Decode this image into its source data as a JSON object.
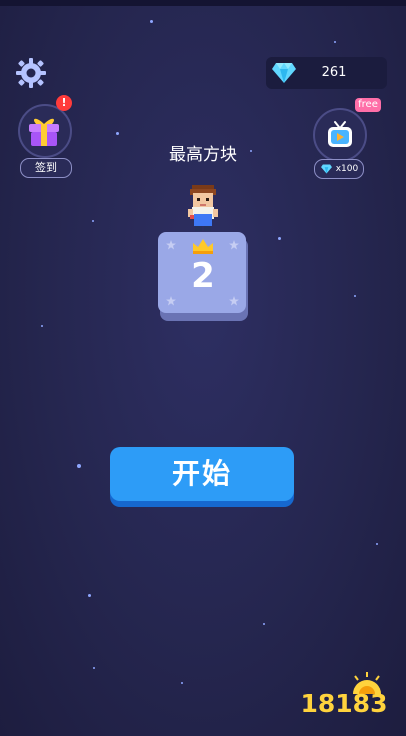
{
  "gems": {
    "count": "261",
    "icon": "diamond-icon"
  },
  "settings": {
    "icon": "gear-icon"
  },
  "checkin": {
    "icon": "gift-box-icon",
    "badge": "!",
    "label": "签到"
  },
  "video_reward": {
    "icon": "tv-play-icon",
    "badge": "free",
    "reward_icon": "diamond-icon",
    "reward": "x100"
  },
  "best_block": {
    "title": "最高方块",
    "value": "2",
    "crown_icon": "crown-icon",
    "character_icon": "boy-character-icon"
  },
  "start_button": {
    "label": "开始"
  },
  "watermark": {
    "text": "18183"
  },
  "colors": {
    "background": "#25264f",
    "button": "#2d9cf7",
    "tile": "#9aa8e7",
    "badge_red": "#ff3b3b",
    "free_pink": "#ff6fa8"
  }
}
